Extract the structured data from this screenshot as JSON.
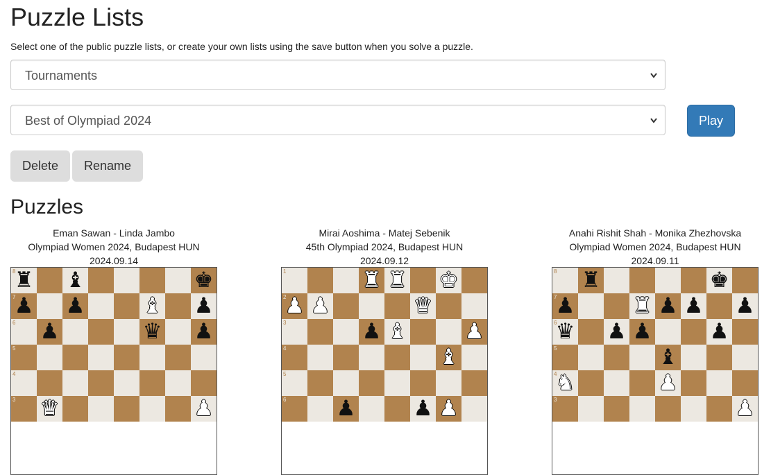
{
  "page": {
    "title": "Puzzle Lists",
    "intro": "Select one of the public puzzle lists, or create your own lists using the save button when you solve a puzzle.",
    "category_select": {
      "value": "Tournaments"
    },
    "list_select": {
      "value": "Best of Olympiad 2024"
    },
    "play_label": "Play",
    "delete_label": "Delete",
    "rename_label": "Rename",
    "puzzles_title": "Puzzles"
  },
  "colors": {
    "light_square": "#ece8e1",
    "dark_square": "#b1834e",
    "play_button": "#337ab7",
    "gray_button": "#dddddd"
  },
  "puzzles": [
    {
      "players": "Eman Sawan - Linda Jambo",
      "event": "Olympiad Women 2024, Budapest HUN",
      "date": "2024.09.14",
      "rank_labels": [
        "8",
        "7",
        "6",
        "5",
        "4",
        "3"
      ],
      "rows": [
        "r.b....k",
        "p.p..B.p",
        ".p...q.p",
        "........",
        "........",
        ".Q.....P"
      ]
    },
    {
      "players": "Mirai Aoshima - Matej Sebenik",
      "event": "45th Olympiad 2024, Budapest HUN",
      "date": "2024.09.12",
      "rank_labels": [
        "1",
        "2",
        "3",
        "4",
        "5",
        "6"
      ],
      "rows": [
        "...RR.K.",
        "PP...Q..",
        "...pB..P",
        "......B.",
        "........",
        "..p..pP."
      ]
    },
    {
      "players": "Anahi Rishit Shah - Monika Zhezhovska",
      "event": "Olympiad Women 2024, Budapest HUN",
      "date": "2024.09.11",
      "rank_labels": [
        "8",
        "7",
        "6",
        "5",
        "4",
        "3"
      ],
      "rows": [
        ".r....k.",
        "p..Rpp.p",
        "q.pp..p.",
        "....b...",
        "N...P...",
        ".......P"
      ]
    }
  ]
}
